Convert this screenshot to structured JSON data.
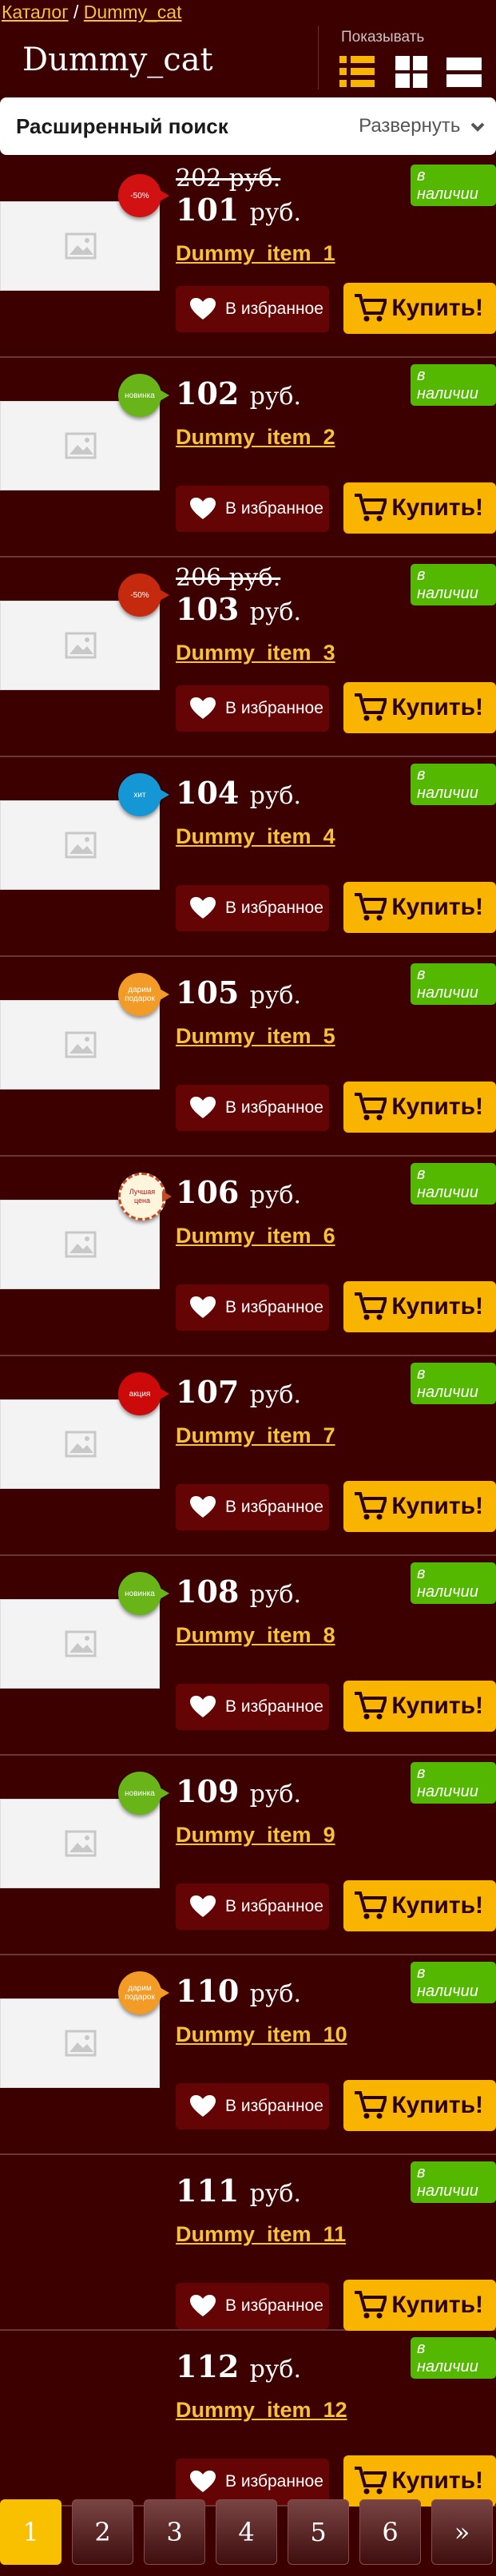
{
  "breadcrumb": {
    "catalog": "Каталог",
    "separator": "/",
    "current": "Dummy_cat"
  },
  "header": {
    "title": "Dummy_cat",
    "view_label": "Показывать"
  },
  "search": {
    "title": "Расширенный поиск",
    "toggle": "Развернуть"
  },
  "labels": {
    "currency": "руб.",
    "stock": "в наличии",
    "fav": "В избранное",
    "buy": "Купить!"
  },
  "products": [
    {
      "name": "Dummy_item_1",
      "price": "101",
      "old": "202 руб.",
      "badge": "-50%",
      "badge_type": "sale"
    },
    {
      "name": "Dummy_item_2",
      "price": "102",
      "old": "",
      "badge": "новинка",
      "badge_type": "new"
    },
    {
      "name": "Dummy_item_3",
      "price": "103",
      "old": "206 руб.",
      "badge": "-50%",
      "badge_type": "sale2"
    },
    {
      "name": "Dummy_item_4",
      "price": "104",
      "old": "",
      "badge": "хит",
      "badge_type": "hit"
    },
    {
      "name": "Dummy_item_5",
      "price": "105",
      "old": "",
      "badge": "дарим подарок",
      "badge_type": "gift"
    },
    {
      "name": "Dummy_item_6",
      "price": "106",
      "old": "",
      "badge": "Лучшая цена",
      "badge_type": "best"
    },
    {
      "name": "Dummy_item_7",
      "price": "107",
      "old": "",
      "badge": "акция",
      "badge_type": "action"
    },
    {
      "name": "Dummy_item_8",
      "price": "108",
      "old": "",
      "badge": "новинка",
      "badge_type": "new"
    },
    {
      "name": "Dummy_item_9",
      "price": "109",
      "old": "",
      "badge": "новинка",
      "badge_type": "new"
    },
    {
      "name": "Dummy_item_10",
      "price": "110",
      "old": "",
      "badge": "дарим подарок",
      "badge_type": "gift"
    },
    {
      "name": "Dummy_item_11",
      "price": "111",
      "old": "",
      "badge": "",
      "badge_type": ""
    },
    {
      "name": "Dummy_item_12",
      "price": "112",
      "old": "",
      "badge": "",
      "badge_type": ""
    }
  ],
  "pagination": {
    "pages": [
      "1",
      "2",
      "3",
      "4",
      "5",
      "6"
    ],
    "next": "»",
    "active": "1"
  },
  "colors": {
    "background": "#3c0000",
    "link": "#f7c23a",
    "buy": "#f9b400",
    "stock": "#55b800"
  }
}
